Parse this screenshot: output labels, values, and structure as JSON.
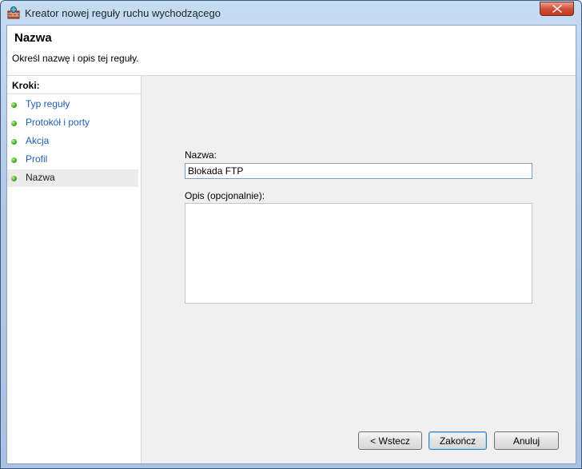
{
  "window": {
    "title": "Kreator nowej reguły ruchu wychodzącego"
  },
  "header": {
    "title": "Nazwa",
    "description": "Określ nazwę i opis tej reguły."
  },
  "steps": {
    "title": "Kroki:",
    "items": [
      {
        "label": "Typ reguły"
      },
      {
        "label": "Protokół i porty"
      },
      {
        "label": "Akcja"
      },
      {
        "label": "Profil"
      },
      {
        "label": "Nazwa"
      }
    ]
  },
  "form": {
    "name_label": "Nazwa:",
    "name_value": "Blokada FTP",
    "description_label": "Opis (opcjonalnie):",
    "description_value": ""
  },
  "buttons": {
    "back": "< Wstecz",
    "finish": "Zakończ",
    "cancel": "Anuluj"
  },
  "icons": {
    "app": "firewall-icon",
    "close": "close-icon",
    "step": "green-dot-icon"
  },
  "colors": {
    "step_link": "#2060b0",
    "close_button": "#c2381f",
    "step_dot": "#3fa820"
  }
}
